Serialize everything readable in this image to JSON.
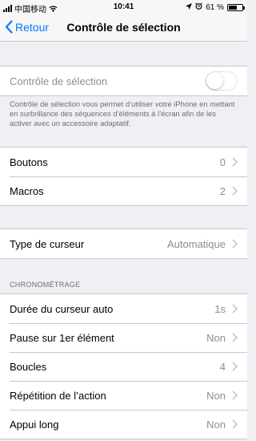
{
  "status_bar": {
    "carrier": "中国移动",
    "time": "10:41",
    "battery": "61 %",
    "battery_level": 0.61
  },
  "nav": {
    "back_label": "Retour",
    "title": "Contrôle de sélection"
  },
  "switch_control": {
    "label": "Contrôle de sélection",
    "enabled": false,
    "description": "Contrôle de sélection vous permet d’utiliser votre iPhone en mettant en surbrillance des séquences d’éléments à l’écran afin de les activer avec un accessoire adaptatif."
  },
  "group1": [
    {
      "label": "Boutons",
      "value": "0"
    },
    {
      "label": "Macros",
      "value": "2"
    }
  ],
  "group2": [
    {
      "label": "Type de curseur",
      "value": "Automatique"
    }
  ],
  "timing": {
    "header": "CHRONOMÉTRAGE",
    "items": [
      {
        "label": "Durée du curseur auto",
        "value": "1s"
      },
      {
        "label": "Pause sur 1er élément",
        "value": "Non"
      },
      {
        "label": "Boucles",
        "value": "4"
      },
      {
        "label": "Répétition de l’action",
        "value": "Non"
      },
      {
        "label": "Appui long",
        "value": "Non"
      }
    ]
  }
}
